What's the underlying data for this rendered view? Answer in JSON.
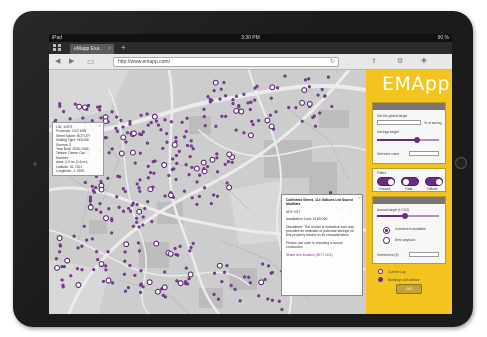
{
  "status": {
    "carrier": "iPad",
    "time": "3:30 PM",
    "battery": "90 %"
  },
  "browser": {
    "tab_title": "eMapp Exa..",
    "tab_close": "×",
    "new_tab": "+",
    "url": "http://www.emapp.com/"
  },
  "map_info": {
    "close": "×",
    "rows": [
      {
        "k": "LID:",
        "v": "10071"
      },
      {
        "k": "Postcode:",
        "v": "OX2 6SN"
      },
      {
        "k": "Street Name:",
        "v": "BOTLEY"
      },
      {
        "k": "Dwlling Type:",
        "v": "HOUSE"
      },
      {
        "k": "Storeys:",
        "v": "2"
      },
      {
        "k": "Year Built:",
        "v": "1930-1945"
      },
      {
        "k": "Tenure:",
        "v": "Owner Occ"
      },
      {
        "k": "Number:",
        "v": ""
      },
      {
        "k": "Area:",
        "v": "0.0 m² (4.6 m²)"
      },
      {
        "k": "Latitude:",
        "v": "51.7521"
      },
      {
        "k": "Longitude:",
        "v": "-1.2925"
      }
    ]
  },
  "popup": {
    "close": "×",
    "title": "California Street, 114 Gallons Ltd Sound Mudflats",
    "subtitle": "ARY 0ST",
    "line1_k": "Installation Cost:",
    "line1_v": "£180,000",
    "body": "Disclaimer: The model is indicative and only provides an estimate of potential savings for this property based on its characteristics.",
    "body2": "Please use care in reaching a sound conclusion.",
    "link": "Share this location (ID77-001)"
  },
  "panel": {
    "logo": "EMApp",
    "card1": {
      "l1": "Set the global target",
      "l2": "% of saving",
      "l3": "Savings target",
      "l4": "Selected value"
    },
    "card2": {
      "title": "Filters",
      "t1": "Houses",
      "t2": "Flats",
      "t3": "Offices"
    },
    "card3": {
      "l1": "Annual target (t CO2)",
      "l2": "Investment available",
      "l3": "Best payback",
      "l4": "Investment (£)"
    },
    "legend": [
      {
        "label": "Current Lay",
        "color": "#ffffff"
      },
      {
        "label": "Buildings with advice",
        "color": "#6b2b85"
      }
    ],
    "go_button": "GO"
  },
  "colors": {
    "accent": "#6b2b85",
    "panel_bg": "#f2c41d",
    "map_bg": "#cdcdcd"
  },
  "icons": [
    "tabs-grid-icon",
    "back-icon",
    "forward-icon",
    "bookmarks-icon",
    "reload-icon",
    "share-icon",
    "settings-icon",
    "add-bookmark-icon",
    "close-icon"
  ]
}
